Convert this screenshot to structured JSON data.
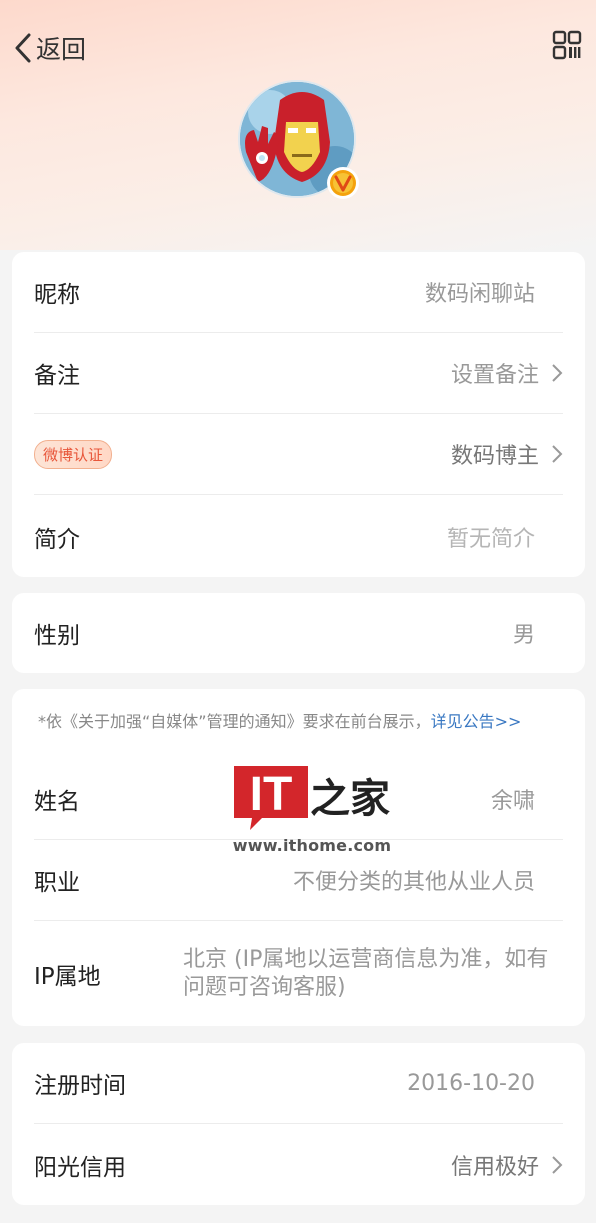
{
  "nav": {
    "back_label": "返回"
  },
  "profile": {
    "nickname_label": "昵称",
    "nickname_value": "数码闲聊站",
    "remark_label": "备注",
    "remark_value": "设置备注",
    "cert_tag": "微博认证",
    "cert_value": "数码博主",
    "bio_label": "简介",
    "bio_value": "暂无简介"
  },
  "gender": {
    "label": "性别",
    "value": "男"
  },
  "realname": {
    "notice": "*依《关于加强“自媒体”管理的通知》要求在前台展示，",
    "notice_link": "详见公告>>",
    "name_label": "姓名",
    "name_value": "余啸",
    "job_label": "职业",
    "job_value": "不便分类的其他从业人员",
    "ip_label": "IP属地",
    "ip_value": "北京 (IP属地以运营商信息为准，如有问题可咨询客服)"
  },
  "account": {
    "reg_label": "注册时间",
    "reg_value": "2016-10-20",
    "credit_label": "阳光信用",
    "credit_value": "信用极好"
  },
  "watermark": {
    "logo_text": "IT",
    "logo_cn": "之家",
    "domain": "www.ithome.com"
  },
  "colors": {
    "accent_link": "#3a78c2",
    "cert_red": "#e8563a",
    "watermark_red": "#d3262b"
  },
  "icons": {
    "back": "chevron-left-icon",
    "qr": "qr-code-icon",
    "verified": "verified-v-badge-icon",
    "row_arrow": "chevron-right-icon"
  }
}
